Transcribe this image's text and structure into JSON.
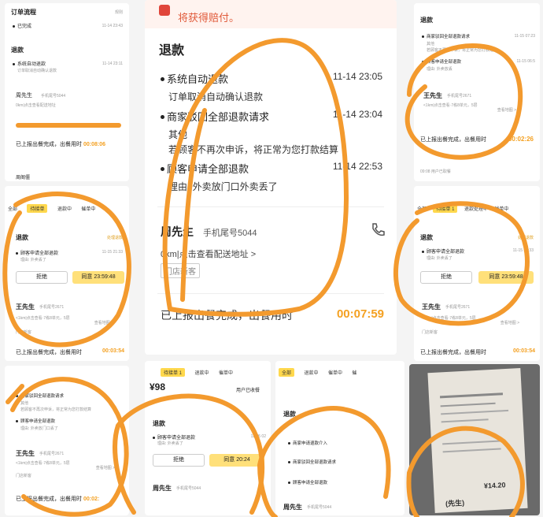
{
  "tl": {
    "order_status": "订单流程",
    "rule": "规则",
    "item1": "已完成",
    "item1_time": "11-14 23:43",
    "refund_title": "退款",
    "r1": "系统自动退款",
    "r1_time": "11-14 23:11",
    "r1_sub": "订单取消自动确认退款",
    "customer": "周先生",
    "phone_tail": "手机尾号5044",
    "addr": "0km|点击查看配送地址",
    "report": "已上报出餐完成，出餐用时",
    "timer": "00:08:06",
    "bottom": "周阁僵"
  },
  "center": {
    "warn": "将获得赔付。",
    "refund_title": "退款",
    "items": [
      {
        "label": "系统自动退款",
        "time": "11-14 23:05",
        "sub": "订单取消自动确认退款",
        "sub2": ""
      },
      {
        "label": "商家驳回全部退款请求",
        "time": "11-14 23:04",
        "sub": "其他",
        "sub2": "若顾客不再次申诉，将正常为您打款结算"
      },
      {
        "label": "顾客申请全部退款",
        "time": "11-14 22:53",
        "sub": "理由: 外卖放门口外卖丢了",
        "sub2": ""
      }
    ],
    "customer": "周先生",
    "phone_tail": "手机尾号5044",
    "addr": "0km|点击查看配送地址 >",
    "new_tag": "门店新客",
    "report": "已上报出餐完成，出餐用时",
    "timer": "00:07:59"
  },
  "tr": {
    "refund_title": "退款",
    "i1": "商家驳回全部退款请求",
    "i1_time": "11-15 07:23",
    "i1_sub": "其他",
    "i1_sub2": "若顾客不再次申诉，将正常为您打款结算",
    "i2": "顾客申请全部退款",
    "i2_time": "11-15 06:5",
    "i2_sub": "理由: 外卖放丢",
    "customer": "王先生",
    "phone_tail": "手机尾号2671",
    "addr": "<1km|点击查看·7栋8单元，5层",
    "map": "查看地图 >",
    "report": "已上报出餐完成，出餐用时",
    "timer": "00:02:26",
    "bottom": "09:08 用户已取餐"
  },
  "ml": {
    "tabs": [
      "全部",
      "待接单",
      "退款中",
      "催单中"
    ],
    "refund_title": "退款",
    "handle": "处理退款",
    "item": "顾客申请全部退款",
    "item_time": "11-15 21:33",
    "item_sub": "理由: 外卖丢了",
    "reject": "拒绝",
    "agree": "同意 23:59:48",
    "customer": "王先生",
    "phone_tail": "手机尾号2671",
    "addr": "<1km|点击查看·7栋8单元，5层",
    "map": "查看地图 >",
    "tag": "门店新客",
    "report": "已上报出餐完成，出餐用时",
    "timer": "00:03:54"
  },
  "mr": {
    "tabs": [
      "全部",
      "待接单 1",
      "退款处理中",
      "催单中",
      "催"
    ],
    "refund_title": "退款",
    "handle": "处理退款",
    "item": "顾客申请全部退款",
    "item_time": "11-15 21:33",
    "item_sub": "理由: 外卖丢了",
    "reject": "拒绝",
    "agree": "同意 23:59:48",
    "customer": "王先生",
    "phone_tail": "手机尾号2671",
    "addr": "<1km|点击查看·7栋8单元，5层",
    "map": "查看地图 >",
    "tag": "门店新客",
    "report": "已上报出餐完成，出餐用时",
    "timer": "00:03:54"
  },
  "bl": {
    "i1": "商家驳回全部退款请求",
    "i1_sub": "其他",
    "i1_sub2": "若顾客不再次申诉，将正常为您打款结算",
    "i2": "顾客申请全部退款",
    "i2_sub": "理由: 外卖放门口丢了",
    "customer": "王先生",
    "phone_tail": "手机尾号2671",
    "addr": "<1km|点击查看·7栋8单元，5层",
    "map": "查看地图 >",
    "tag": "门店新客",
    "report": "已上报出餐完成，出餐用时",
    "timer": "00:02:"
  },
  "bc": {
    "tabs": [
      "待接单 1",
      "退款中",
      "催单中"
    ],
    "price": "¥98",
    "status": "用户已收餐",
    "refund_title": "退款",
    "item": "顾客申请全部退款",
    "item_time": "11-15 02",
    "item_sub": "理由: 外卖丢了",
    "reject": "拒绝",
    "agree": "同意 20:24",
    "customer": "周先生",
    "phone_tail": "手机尾号5044"
  },
  "bm": {
    "tabs": [
      "全部",
      "退款中",
      "催单中",
      "催"
    ],
    "refund_title": "退款",
    "items": [
      "商家申请退款介入",
      "商家驳回全部退款请求",
      "顾客申请全部退款"
    ],
    "customer": "周先生",
    "phone_tail": "手机尾号5044"
  },
  "br": {
    "amount": "¥14.20",
    "name": "(先生)"
  }
}
